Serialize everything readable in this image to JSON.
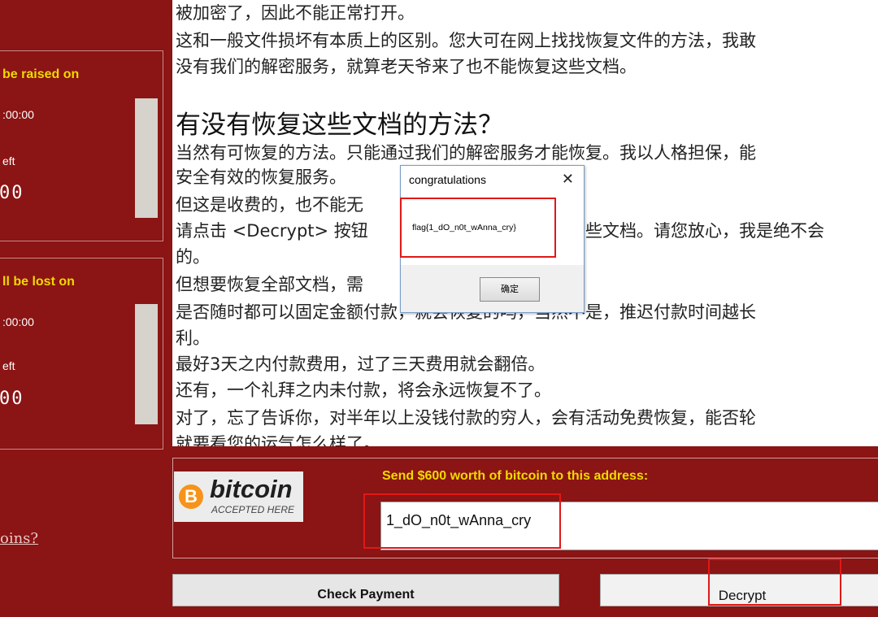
{
  "timers": [
    {
      "label": "be raised on",
      "time": ":00:00",
      "left_label": "eft",
      "digits": "00"
    },
    {
      "label": "ll be lost on",
      "time": ":00:00",
      "left_label": "eft",
      "digits": "00"
    }
  ],
  "left_link": "oins?",
  "main_text": {
    "lines_top": [
      "被加密了，因此不能正常打开。",
      "这和一般文件损坏有本质上的区别。您大可在网上找找恢复文件的方法，我敢",
      "没有我们的解密服务，就算老天爷来了也不能恢复这些文档。"
    ],
    "heading": "有没有恢复这些文档的方法？",
    "lines_body": [
      "当然有可恢复的方法。只能通过我们的解密服务才能恢复。我以人格担保，能",
      "安全有效的恢复服务。",
      "但这是收费的，也不能无",
      "请点击 <Decrypt> 按钮",
      "的。",
      "但想要恢复全部文档，需",
      "是否随时都可以固定金额付款，就会恢复的吗，当然不是，推迟付款时间越长",
      "利。",
      "最好3天之内付款费用，过了三天费用就会翻倍。",
      "还有，一个礼拜之内未付款，将会永远恢复不了。",
      "对了，忘了告诉你，对半年以上没钱付款的穷人，会有活动免费恢复，能否轮",
      "就要看您的运气怎么样了。"
    ],
    "line_fragment_right": "些文档。请您放心，我是绝不会"
  },
  "dialog": {
    "title": "congratulations",
    "close_glyph": "✕",
    "message": "flag{1_dO_n0t_wAnna_cry}",
    "ok_label": "确定"
  },
  "payment": {
    "bitcoin_word": "bitcoin",
    "bitcoin_sub": "ACCEPTED HERE",
    "bitcoin_b": "B",
    "send_label": "Send $600 worth of bitcoin to this address:",
    "address": "1_dO_n0t_wAnna_cry"
  },
  "buttons": {
    "check_payment": "Check Payment",
    "decrypt": "Decrypt"
  },
  "colors": {
    "background": "#8b1414",
    "accent_yellow": "#f1d900",
    "highlight_red": "#e01818",
    "bitcoin_orange": "#f7931a"
  }
}
